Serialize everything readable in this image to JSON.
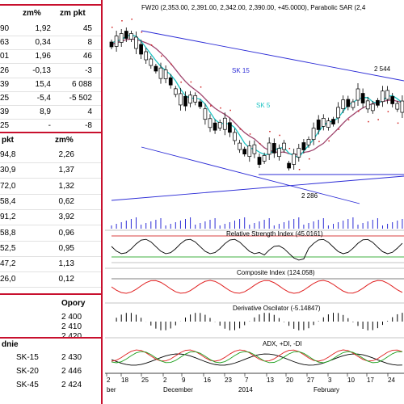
{
  "table1": {
    "headers": [
      "zm%",
      "zm pkt"
    ],
    "rows": [
      {
        "a": "90",
        "b": "1,92",
        "c": "45"
      },
      {
        "a": "63",
        "b": "0,34",
        "c": "8"
      },
      {
        "a": "01",
        "b": "1,96",
        "c": "46"
      },
      {
        "a": "26",
        "b": "-0,13",
        "c": "-3"
      },
      {
        "a": "39",
        "b": "15,4",
        "c": "6 088"
      },
      {
        "a": "25",
        "b": "-5,4",
        "c": "-5 502"
      },
      {
        "a": "39",
        "b": "8,9",
        "c": "4"
      },
      {
        "a": "25",
        "b": "-",
        "c": "-8"
      }
    ]
  },
  "table2": {
    "headers": [
      "pkt",
      "zm%"
    ],
    "rows": [
      {
        "a": "94,8",
        "b": "2,26"
      },
      {
        "a": "30,9",
        "b": "1,37"
      },
      {
        "a": "72,0",
        "b": "1,32"
      },
      {
        "a": "58,4",
        "b": "0,62"
      },
      {
        "a": "91,2",
        "b": "3,92"
      },
      {
        "a": "58,8",
        "b": "0,96"
      },
      {
        "a": "52,5",
        "b": "0,95"
      },
      {
        "a": "47,2",
        "b": "1,13"
      },
      {
        "a": "26,0",
        "b": "0,12"
      }
    ]
  },
  "opory": {
    "title": "Opory",
    "values": [
      "2 400",
      "2 410",
      "2 420"
    ]
  },
  "srednie": {
    "title": "dnie",
    "rows": [
      {
        "label": "SK-15",
        "value": "2 430"
      },
      {
        "label": "SK-20",
        "value": "2 446"
      },
      {
        "label": "SK-45",
        "value": "2 424"
      }
    ]
  },
  "chart": {
    "header": "FW20 (2,353.00, 2,391.00, 2,342.00, 2,390.00, +45.0000), Parabolic SAR (2,4",
    "labels": {
      "sk15": "SK 15",
      "sk5": "SK 5",
      "high": "2 544",
      "low": "2 286"
    },
    "panels": {
      "rsi": "Relative Strength Index (45.0161)",
      "composite": "Composite Index (124.058)",
      "derivative": "Derivative Oscilator (-5.14847)",
      "adx": "ADX, +DI, -DI"
    },
    "xaxis": {
      "days": [
        "2",
        "18",
        "25",
        "2",
        "9",
        "16",
        "23",
        "7",
        "13",
        "20",
        "27",
        "3",
        "10",
        "17",
        "24"
      ],
      "months": [
        "ber",
        "December",
        "2014",
        "February"
      ]
    },
    "colors": {
      "candle": "#000000",
      "sk15": "#a0466e",
      "sk5": "#1ec3c3",
      "trend": "#2b2bd6",
      "sar": "#d02020"
    }
  }
}
